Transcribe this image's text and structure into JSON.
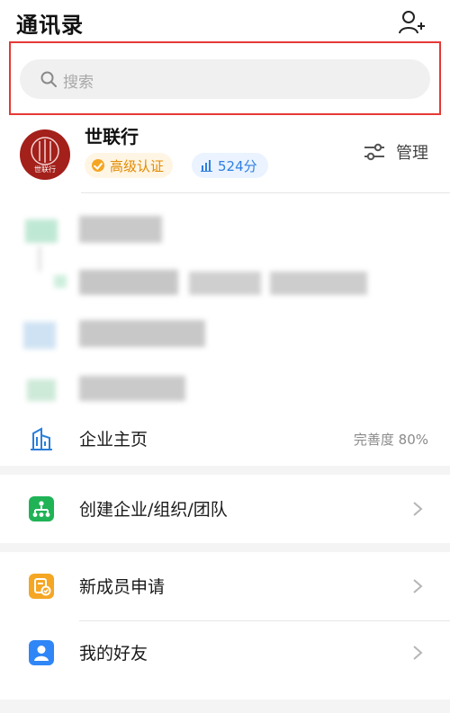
{
  "header": {
    "title": "通讯录",
    "add_friend_icon": "add-user-icon"
  },
  "search": {
    "placeholder": "搜索",
    "icon": "search-icon",
    "highlight_color": "#e53935"
  },
  "organization": {
    "name": "世联行",
    "logo_text": "世联行",
    "logo_color": "#a3201b",
    "certification": "高级认证",
    "score": "524分",
    "manage_label": "管理"
  },
  "menu": {
    "enterprise_home": {
      "label": "企业主页",
      "completeness": "完善度 80%",
      "icon": "building-icon"
    },
    "create_org": {
      "label": "创建企业/组织/团队",
      "icon": "org-chart-icon",
      "icon_color": "#1fb356"
    },
    "new_member": {
      "label": "新成员申请",
      "icon": "member-request-icon",
      "icon_color": "#f5a623"
    },
    "my_friends": {
      "label": "我的好友",
      "icon": "user-icon",
      "icon_color": "#2f86f6"
    }
  }
}
